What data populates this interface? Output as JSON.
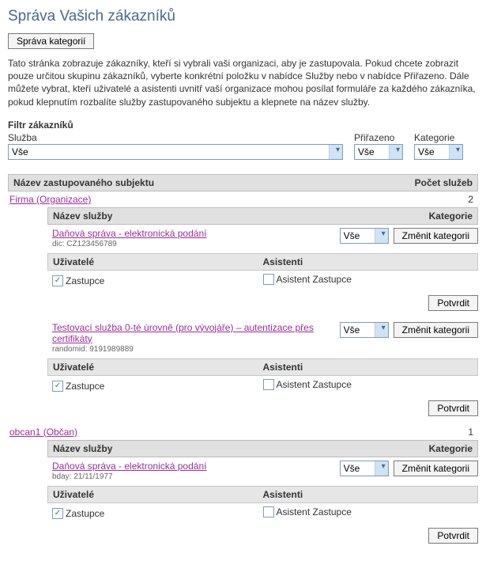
{
  "page": {
    "title": "Správa Vašich zákazníků",
    "manage_categories_btn": "Správa kategorií",
    "description": "Tato stránka zobrazuje zákazníky, kteří si vybrali vaši organizaci, aby je zastupovala. Pokud chcete zobrazit pouze určitou skupinu zákazníků, vyberte konkrétní položku v nabídce Služby nebo v nabídce Přiřazeno. Dále můžete vybrat, kteří uživatelé a asistenti uvnitř vaší organizace mohou posílat formuláře za každého zákazníka, pokud klepnutím rozbalíte služby zastupovaného subjektu a klepnete na název služby."
  },
  "filters": {
    "heading": "Filtr zákazníků",
    "service_label": "Služba",
    "service_value": "Vše",
    "assigned_label": "Přiřazeno",
    "assigned_value": "Vše",
    "category_label": "Kategorie",
    "category_value": "Vše"
  },
  "table": {
    "subject_header": "Název zastupovaného subjektu",
    "count_header": "Počet služeb",
    "service_header": "Název služby",
    "category_header": "Kategorie",
    "users_header": "Uživatelé",
    "assistants_header": "Asistenti",
    "change_category_btn": "Změnit kategorii",
    "confirm_btn": "Potvrdit",
    "cat_select_value": "Vše",
    "user_cb_label": "Zastupce",
    "assistant_cb_label": "Asistent Zastupce"
  },
  "subjects": [
    {
      "name": "Firma (Organizace)",
      "count": "2",
      "services": [
        {
          "title": "Daňová správa - elektronická podání",
          "id_label": "dic: CZ123456789",
          "user_checked": true,
          "assistant_checked": false
        },
        {
          "title": "Testovací služba 0-té úrovně (pro vývojáře) – autentizace přes certifikáty",
          "id_label": "randomid: 9191989889",
          "user_checked": true,
          "assistant_checked": false
        }
      ]
    },
    {
      "name": "obcan1 (Občan)",
      "count": "1",
      "services": [
        {
          "title": "Daňová správa - elektronická podání",
          "id_label": "bday: 21/11/1977",
          "user_checked": true,
          "assistant_checked": false
        }
      ]
    }
  ]
}
